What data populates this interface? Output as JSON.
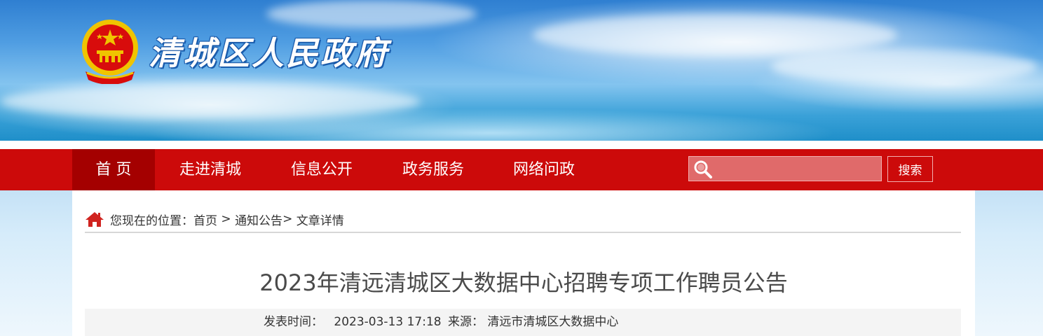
{
  "site": {
    "title": "清城区人民政府"
  },
  "nav": {
    "items": [
      {
        "label": "首 页",
        "active": true
      },
      {
        "label": "走进清城",
        "active": false
      },
      {
        "label": "信息公开",
        "active": false
      },
      {
        "label": "政务服务",
        "active": false
      },
      {
        "label": "网络问政",
        "active": false
      }
    ],
    "search_placeholder": "",
    "search_button": "搜索"
  },
  "breadcrumb": {
    "prefix": "您现在的位置：",
    "items": [
      "首页",
      "通知公告",
      "文章详情"
    ],
    "separators": [
      " > ",
      "> "
    ]
  },
  "article": {
    "title": "2023年清远清城区大数据中心招聘专项工作聘员公告",
    "published_label": "发表时间：",
    "published_value": "2023-03-13 17:18",
    "source_label": "来源：",
    "source_value": "清远市清城区大数据中心"
  },
  "colors": {
    "nav_red": "#cc0a0a",
    "nav_active": "#a40000",
    "title_text": "#4a4a4a"
  },
  "icons": {
    "emblem": "national-emblem-icon",
    "search": "search-icon",
    "home": "home-icon"
  }
}
